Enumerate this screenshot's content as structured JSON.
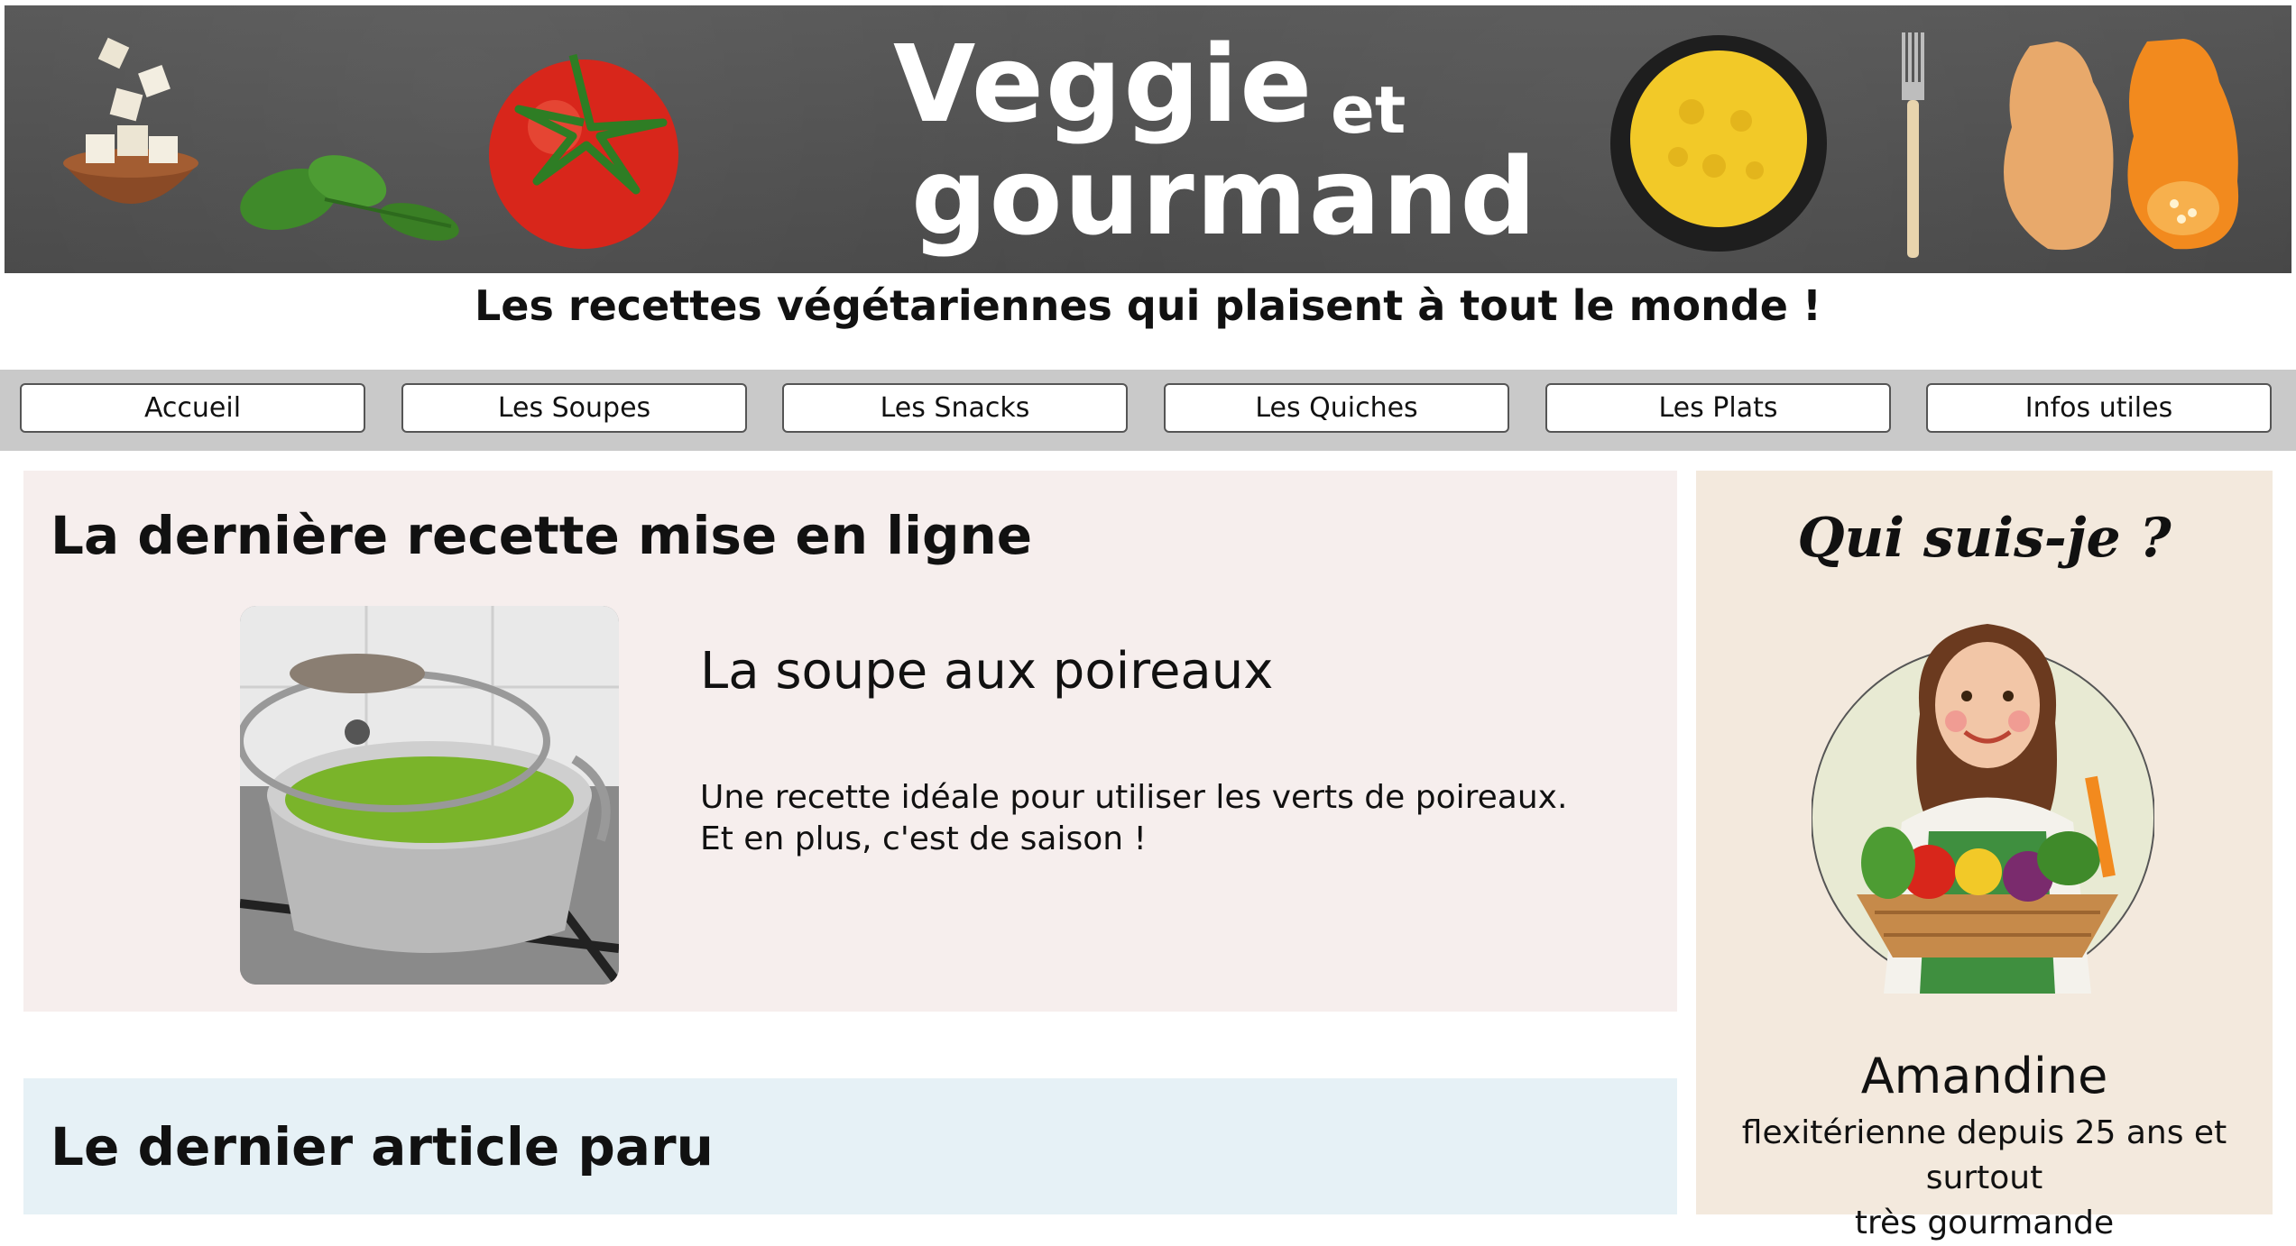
{
  "site": {
    "logo_line1": "Veggie",
    "logo_line1b": "et",
    "logo_line2": "gourmand",
    "tagline": "Les recettes végétariennes qui plaisent à tout le monde !"
  },
  "nav": {
    "items": [
      {
        "label": "Accueil"
      },
      {
        "label": "Les Soupes"
      },
      {
        "label": "Les Snacks"
      },
      {
        "label": "Les Quiches"
      },
      {
        "label": "Les Plats"
      },
      {
        "label": "Infos utiles"
      }
    ]
  },
  "latest_recipe": {
    "heading": "La dernière recette mise en ligne",
    "title": "La soupe aux poireaux",
    "desc_line1": "Une recette idéale pour utiliser les verts de poireaux.",
    "desc_line2": "Et en plus, c'est de saison !"
  },
  "latest_article": {
    "heading": "Le dernier article paru"
  },
  "sidebar": {
    "title": "Qui suis-je ?",
    "name": "Amandine",
    "desc_line1": "flexitérienne depuis 25 ans et surtout",
    "desc_line2": "très gourmande"
  },
  "colors": {
    "banner": "#4f4f4f",
    "recipe_card": "#f6eeed",
    "article_card": "#e6f1f6",
    "sidebar": "#f3e9dd",
    "navbar": "#c9c9c9"
  }
}
